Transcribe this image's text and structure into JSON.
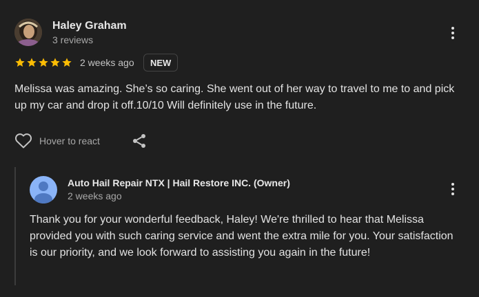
{
  "review": {
    "reviewer_name": "Haley Graham",
    "reviewer_meta": "3 reviews",
    "rating": 5,
    "rating_max": 5,
    "date": "2 weeks ago",
    "badge": "NEW",
    "text": "Melissa was amazing. She’s so caring. She went out of her way to travel to me to and pick up my car and drop it off.10/10 Will definitely use in the future.",
    "react_label": "Hover to react",
    "star_color": "#fbbc04"
  },
  "reply": {
    "owner_name": "Auto Hail Repair NTX | Hail Restore INC. (Owner)",
    "date": "2 weeks ago",
    "text": "Thank you for your wonderful feedback, Haley! We're thrilled to hear that Melissa provided you with such caring service and went the extra mile for you. Your satisfaction is our priority, and we look forward to assisting you again in the future!",
    "avatar_color": "#8ab4f8"
  }
}
